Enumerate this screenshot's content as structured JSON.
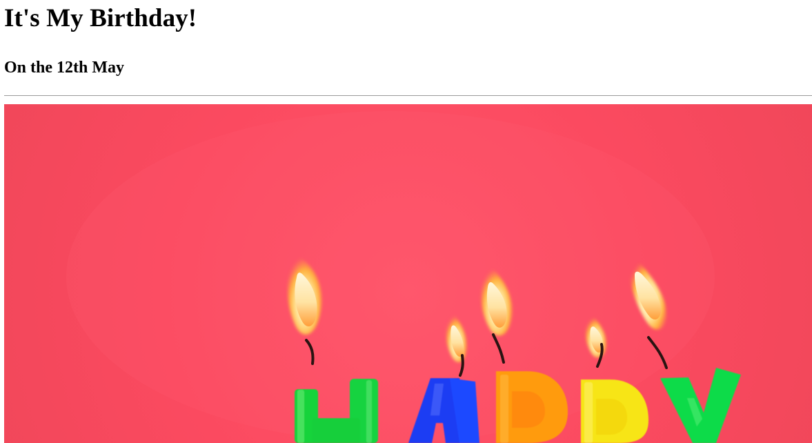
{
  "page": {
    "title": "It's My Birthday!",
    "subtitle": "On the 12th May"
  },
  "photo": {
    "description_icon": "birthday-candles-photo",
    "background_color": "#f94b62",
    "candles": [
      {
        "letter": "H",
        "color": "#16d53d"
      },
      {
        "letter": "A",
        "color": "#1a3cf2"
      },
      {
        "letter": "P",
        "color": "#ff9a0a"
      },
      {
        "letter": "P",
        "color": "#f8e313"
      },
      {
        "letter": "Y",
        "color": "#12db4a"
      }
    ]
  }
}
